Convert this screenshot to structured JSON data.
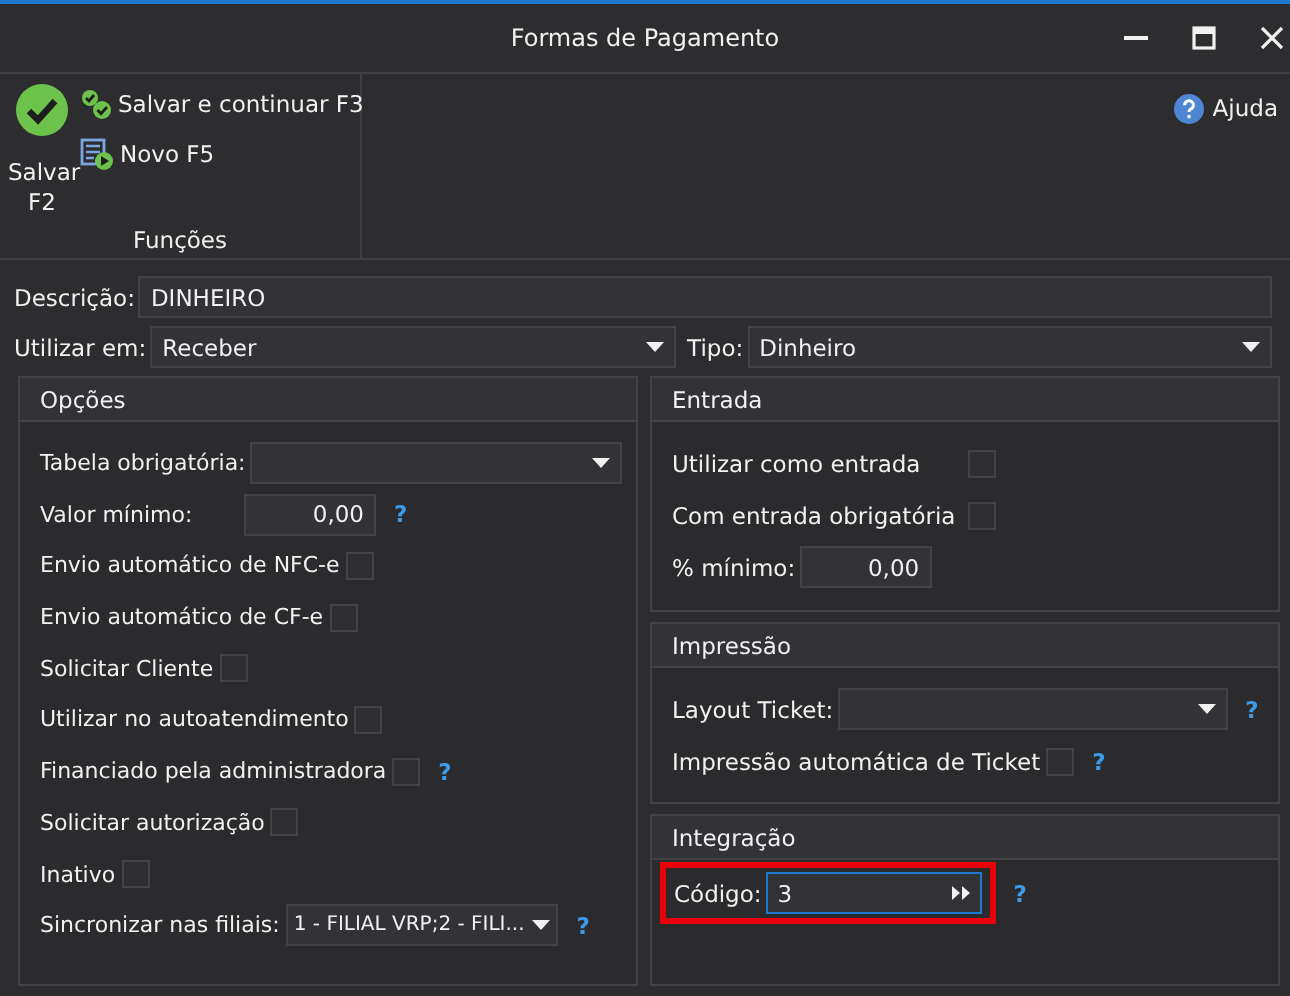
{
  "window": {
    "title": "Formas de Pagamento"
  },
  "ribbon": {
    "main_button": {
      "label": "Salvar F2"
    },
    "small_buttons": [
      {
        "label": "Salvar e continuar F3",
        "kind": "save-continue"
      },
      {
        "label": "Novo F5",
        "kind": "new"
      }
    ],
    "group_label": "Funções",
    "help": {
      "label": "Ajuda"
    }
  },
  "form": {
    "descricao": {
      "label": "Descrição:",
      "value": "DINHEIRO"
    },
    "utilizar_em": {
      "label": "Utilizar em:",
      "value": "Receber"
    },
    "tipo": {
      "label": "Tipo:",
      "value": "Dinheiro"
    }
  },
  "left_panel": {
    "title": "Opções",
    "rows": [
      {
        "kind": "select",
        "label": "Tabela obrigatória:"
      },
      {
        "kind": "number",
        "label": "Valor mínimo:",
        "value": "0,00",
        "help": "?"
      },
      {
        "kind": "checkbox",
        "label": "Envio automático de NFC-e",
        "checked": false
      },
      {
        "kind": "checkbox",
        "label": "Envio automático de CF-e",
        "checked": false
      },
      {
        "kind": "checkbox",
        "label": "Solicitar Cliente",
        "checked": false
      },
      {
        "kind": "checkbox",
        "label": "Utilizar no autoatendimento",
        "checked": false
      },
      {
        "kind": "checkbox",
        "label": "Financiado pela administradora",
        "checked": false,
        "help": "?"
      },
      {
        "kind": "checkbox",
        "label": "Solicitar autorização",
        "checked": false
      },
      {
        "kind": "checkbox",
        "label": "Inativo",
        "checked": false
      },
      {
        "kind": "select",
        "label": "Sincronizar nas filiais:",
        "value": "1 - FILIAL VRP;2 - FILI...",
        "help": "?"
      }
    ]
  },
  "right_panels": [
    {
      "title": "Entrada",
      "rows": [
        {
          "kind": "checkbox",
          "label": "Utilizar como entrada",
          "checked": false
        },
        {
          "kind": "checkbox",
          "label": "Com entrada obrigatória",
          "checked": false
        },
        {
          "kind": "number",
          "label": "% mínimo:",
          "value": "0,00"
        }
      ]
    },
    {
      "title": "Impressão",
      "rows": [
        {
          "kind": "select",
          "label": "Layout Ticket:",
          "help": "?"
        },
        {
          "kind": "checkbox",
          "label": "Impressão automática de Ticket",
          "checked": false,
          "help": "?"
        }
      ]
    },
    {
      "title": "Integração",
      "rows": [
        {
          "kind": "code",
          "label": "Código:",
          "value": "3",
          "help": "?",
          "highlighted": true
        }
      ]
    }
  ]
}
